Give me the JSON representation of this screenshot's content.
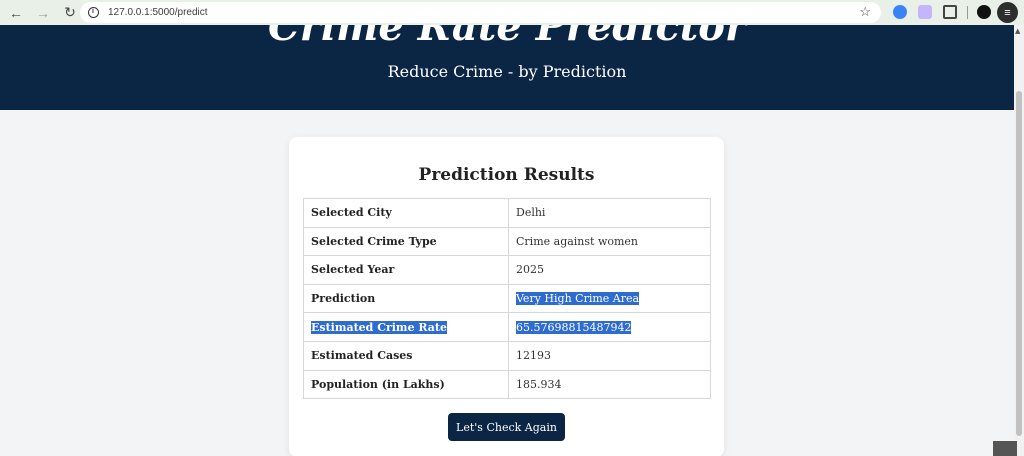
{
  "browser": {
    "url": "127.0.0.1:5000/predict",
    "back_icon": "←",
    "forward_icon": "→",
    "reload_icon": "↻",
    "star_icon": "☆",
    "menu_icon": "≡"
  },
  "header": {
    "title": "Crime Rate Predictor",
    "tagline": "Reduce Crime - by Prediction"
  },
  "results": {
    "heading": "Prediction Results",
    "rows": [
      {
        "label": "Selected City",
        "value": "Delhi"
      },
      {
        "label": "Selected Crime Type",
        "value": "Crime against women"
      },
      {
        "label": "Selected Year",
        "value": "2025"
      },
      {
        "label": "Prediction",
        "value": "Very High Crime Area"
      },
      {
        "label": "Estimated Crime Rate",
        "value": "65.57698815487942"
      },
      {
        "label": "Estimated Cases",
        "value": "12193"
      },
      {
        "label": "Population (in Lakhs)",
        "value": "185.934"
      }
    ],
    "button_label": "Let's Check Again"
  },
  "colors": {
    "header_bg": "#0b2545",
    "selection": "#2f6ccf"
  }
}
